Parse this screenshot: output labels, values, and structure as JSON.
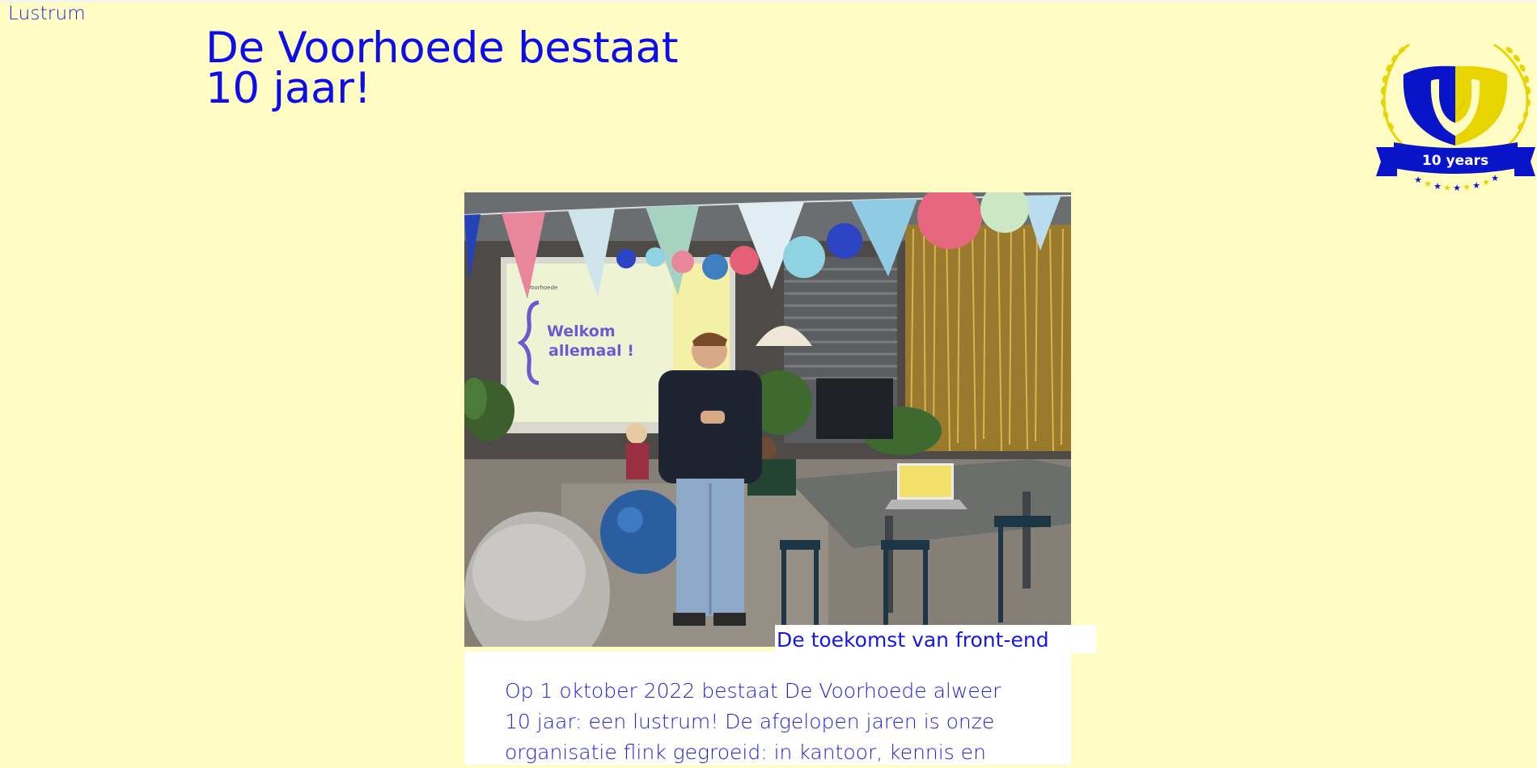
{
  "nav": {
    "brand_link": "Lustrum"
  },
  "header": {
    "title_line1": "De Voorhoede bestaat",
    "title_line2": "10 jaar!"
  },
  "emblem": {
    "icon": "lustrum-10-years-badge-icon",
    "banner_text": "10 years",
    "colors": {
      "blue": "#0a14c8",
      "yellow": "#e8d400"
    }
  },
  "hero": {
    "slide_text_line1": "Welkom",
    "slide_text_line2": "allemaal !",
    "slide_brand": "Voorhoede",
    "caption": "De toekomst van front-end"
  },
  "article": {
    "intro": "Op 1 oktober 2022 bestaat De Voorhoede alweer 10 jaar: een lustrum! De afgelopen jaren is onze organisatie flink gegroeid: in kantoor, kennis en"
  },
  "theme": {
    "background": "#fffcc4",
    "text_accent": "#1414e0",
    "card_background": "#ffffff"
  }
}
